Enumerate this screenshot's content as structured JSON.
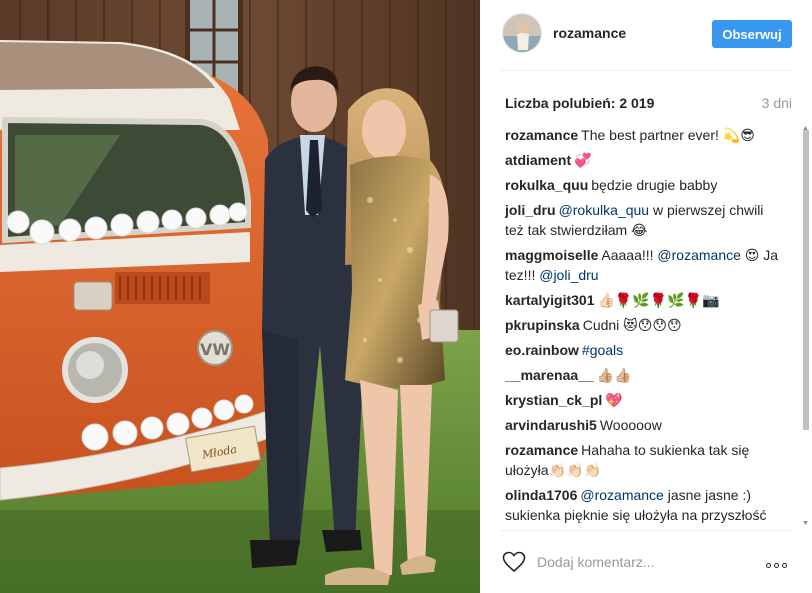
{
  "post": {
    "author": "rozamance",
    "follow_label": "Obserwuj",
    "likes_label": "Liczba polubień:",
    "likes_count": "2 019",
    "time_ago": "3 dni",
    "photo_plate_text": "Młoda",
    "comments": [
      {
        "user": "rozamance",
        "parts": [
          {
            "t": "text",
            "v": "The best partner ever! 💫😎"
          }
        ]
      },
      {
        "user": "atdiament",
        "parts": [
          {
            "t": "text",
            "v": "💞"
          }
        ]
      },
      {
        "user": "rokulka_quu",
        "parts": [
          {
            "t": "text",
            "v": "będzie drugie babby"
          }
        ]
      },
      {
        "user": "joli_dru",
        "parts": [
          {
            "t": "mention",
            "v": "@rokulka_quu"
          },
          {
            "t": "text",
            "v": " w pierwszej chwili też tak stwierdziłam 😂"
          }
        ]
      },
      {
        "user": "maggmoiselle",
        "parts": [
          {
            "t": "text",
            "v": "Aaaaa!!! "
          },
          {
            "t": "mention",
            "v": "@rozamance"
          },
          {
            "t": "text",
            "v": " 😍 Ja tez!!! "
          },
          {
            "t": "mention",
            "v": "@joli_dru"
          }
        ]
      },
      {
        "user": "kartalyigit301",
        "parts": [
          {
            "t": "text",
            "v": "👍🏻🌹🌿🌹🌿🌹📷"
          }
        ]
      },
      {
        "user": "pkrupinska",
        "parts": [
          {
            "t": "text",
            "v": "Cudni 😻😯😯😯"
          }
        ]
      },
      {
        "user": "eo.rainbow",
        "parts": [
          {
            "t": "tag",
            "v": "#goals"
          }
        ]
      },
      {
        "user": "__marenaa__",
        "parts": [
          {
            "t": "text",
            "v": "👍🏼👍🏼"
          }
        ]
      },
      {
        "user": "krystian_ck_pl",
        "parts": [
          {
            "t": "text",
            "v": "💖"
          }
        ]
      },
      {
        "user": "arvindarushi5",
        "parts": [
          {
            "t": "text",
            "v": "Wooooow"
          }
        ]
      },
      {
        "user": "rozamance",
        "parts": [
          {
            "t": "text",
            "v": "Hahaha to sukienka tak się ułożyła👏🏻👏🏻👏🏻"
          }
        ]
      },
      {
        "user": "olinda1706",
        "parts": [
          {
            "t": "mention",
            "v": "@rozamance"
          },
          {
            "t": "text",
            "v": " jasne jasne :) sukienka pięknie się ułożyła na przyszłość chyba 🖤"
          }
        ]
      }
    ]
  },
  "footer": {
    "comment_placeholder": "Dodaj komentarz...",
    "icons": {
      "like": "heart-outline-icon",
      "more": "more-options-icon"
    }
  },
  "colors": {
    "accent": "#3897f0",
    "mention": "#003569",
    "muted": "#999999",
    "text": "#262626"
  }
}
